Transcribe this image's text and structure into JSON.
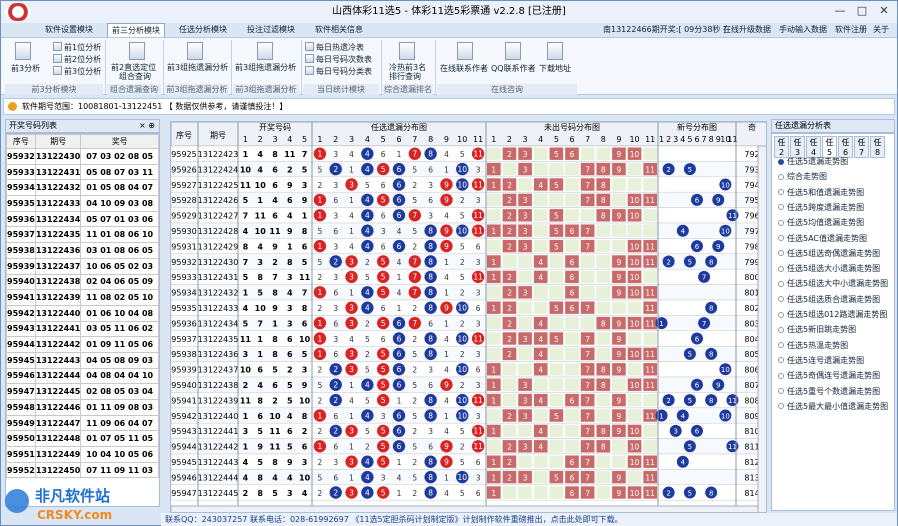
{
  "window": {
    "title": "山西体彩11选5 - 体彩11选5彩票通 v2.2.8 [已注册]"
  },
  "menu": {
    "tabs": [
      "软件设置模块",
      "前三分析模块",
      "任选分析模块",
      "投注过滤模块",
      "软件相关信息"
    ],
    "right": [
      "南13122466期开奖:[ 09分38秒 ]",
      "在线升级数据",
      "手动输入数据",
      "软件注册",
      "关于"
    ]
  },
  "ribbon": {
    "items": [
      {
        "label": "前3分析",
        "icon": "chart-doc-icon"
      },
      {
        "label": "前1位分析",
        "icon": "doc-icon"
      },
      {
        "label": "前2位分析",
        "icon": "doc-icon"
      },
      {
        "label": "前3位分析",
        "icon": "doc-icon"
      },
      {
        "label": "前2直选定位",
        "icon": "doc-icon"
      },
      {
        "label": "组合查询",
        "icon": ""
      },
      {
        "label": "前3组拖遗漏分析",
        "icon": "doc-icon"
      },
      {
        "label": "前3组拖遗漏分析",
        "icon": "doc-icon"
      },
      {
        "label": "每日热遗冷表",
        "icon": "table-icon"
      },
      {
        "label": "每日号码次数表",
        "icon": "table-icon"
      },
      {
        "label": "每日号码分类表",
        "icon": "table-icon"
      },
      {
        "label": "冷热前3名",
        "icon": "search-doc-icon"
      },
      {
        "label": "排行查询",
        "icon": ""
      },
      {
        "label": "在线联系作者",
        "icon": "people-icon"
      },
      {
        "label": "QQ联系作者",
        "icon": "qq-icon"
      },
      {
        "label": "下载地址",
        "icon": "qr-icon"
      }
    ],
    "groups": [
      "前3分析模块",
      "组合遗漏查询",
      "前3组拖遗漏分析",
      "前3组拖遗漏分析",
      "当日统计模块",
      "综合遗漏排名",
      "在线咨询"
    ]
  },
  "infobar": "软件期号范围：10081801-13122451  【 数据仅供参考，请谨慎投注！】",
  "left": {
    "title": "开奖号码列表",
    "cols": [
      "序号",
      "期号",
      "奖号"
    ],
    "rows": [
      [
        "95932",
        "13122430",
        "07 03 02 08 05"
      ],
      [
        "95933",
        "13122431",
        "05 08 07 03 11"
      ],
      [
        "95934",
        "13122432",
        "01 05 08 04 07"
      ],
      [
        "95935",
        "13122433",
        "04 10 09 03 08"
      ],
      [
        "95936",
        "13122434",
        "05 07 01 03 06"
      ],
      [
        "95937",
        "13122435",
        "11 01 08 06 10"
      ],
      [
        "95938",
        "13122436",
        "03 01 08 06 05"
      ],
      [
        "95939",
        "13122437",
        "10 06 05 02 03"
      ],
      [
        "95940",
        "13122438",
        "02 04 06 05 09"
      ],
      [
        "95941",
        "13122439",
        "11 08 02 05 10"
      ],
      [
        "95942",
        "13122440",
        "01 06 10 04 08"
      ],
      [
        "95943",
        "13122441",
        "03 05 11 06 02"
      ],
      [
        "95944",
        "13122442",
        "01 09 11 05 06"
      ],
      [
        "95945",
        "13122443",
        "04 05 08 09 03"
      ],
      [
        "95946",
        "13122444",
        "04 08 04 04 10"
      ],
      [
        "95947",
        "13122445",
        "02 08 05 03 04"
      ],
      [
        "95948",
        "13122446",
        "01 11 09 08 03"
      ],
      [
        "95949",
        "13122447",
        "11 09 06 04 07"
      ],
      [
        "95950",
        "13122448",
        "01 07 05 11 05"
      ],
      [
        "95951",
        "13122449",
        "10 04 10 05 06"
      ],
      [
        "95952",
        "13122450",
        "07 11 09 11 03"
      ]
    ]
  },
  "center": {
    "headers": [
      "序号",
      "期号",
      "开奖号码",
      "任选遗漏分布图",
      "未出号码分布图",
      "新号分布图",
      "奇"
    ],
    "nums": [
      "1",
      "2",
      "3",
      "4",
      "5",
      "6",
      "7",
      "8",
      "9",
      "10",
      "11"
    ],
    "rows": [
      [
        "95925",
        "13122423",
        "1 4 8 11 7",
        "792"
      ],
      [
        "95926",
        "13122424",
        "10 4 6 2 5",
        "793"
      ],
      [
        "95927",
        "13122425",
        "11 10 6 9 3",
        "794"
      ],
      [
        "95928",
        "13122426",
        "5 1 4 6 9",
        "795"
      ],
      [
        "95929",
        "13122427",
        "7 11 6 4 1",
        "796"
      ],
      [
        "95930",
        "13122428",
        "4 10 11 9 8",
        "797"
      ],
      [
        "95931",
        "13122429",
        "8 4 9 1 6",
        "798"
      ],
      [
        "95932",
        "13122430",
        "7 3 2 8 5",
        "799"
      ],
      [
        "95933",
        "13122431",
        "5 8 7 3 11",
        "800"
      ],
      [
        "95934",
        "13122432",
        "1 5 8 4 7",
        "801"
      ],
      [
        "95935",
        "13122433",
        "4 10 9 3 8",
        "802"
      ],
      [
        "95936",
        "13122434",
        "5 7 1 3 6",
        "803"
      ],
      [
        "95937",
        "13122435",
        "11 1 8 6 10",
        "804"
      ],
      [
        "95938",
        "13122436",
        "3 1 8 6 5",
        "805"
      ],
      [
        "95939",
        "13122437",
        "10 6 5 2 3",
        "806"
      ],
      [
        "95940",
        "13122438",
        "2 4 6 5 9",
        "807"
      ],
      [
        "95941",
        "13122439",
        "11 8 2 5 10",
        "808"
      ],
      [
        "95942",
        "13122440",
        "1 6 10 4 8",
        "809"
      ],
      [
        "95943",
        "13122441",
        "3 5 11 6 2",
        "810"
      ],
      [
        "95944",
        "13122442",
        "1 9 11 5 6",
        "811"
      ],
      [
        "95945",
        "13122443",
        "4 5 8 9 3",
        "812"
      ],
      [
        "95946",
        "13122444",
        "4 8 4 4 10",
        "813"
      ],
      [
        "95947",
        "13122445",
        "2 8 5 3 4",
        "814"
      ]
    ]
  },
  "right": {
    "title": "任选遗漏分析表",
    "tabs": [
      "任2",
      "任3",
      "任4",
      "任5",
      "任6",
      "任7",
      "任8"
    ],
    "items": [
      "任选5遗漏走势图",
      "综合走势图",
      "任选5和值遗漏走势图",
      "任选5跨度遗漏走势图",
      "任选5均值遗漏走势图",
      "任选5AC值遗漏走势图",
      "任选5组选奇偶遗漏走势图",
      "任选5组选大小遗漏走势图",
      "任选5组选大中小遗漏走势图",
      "任选5组选质合遗漏走势图",
      "任选5组选012路遗漏走势图",
      "任选5新旧跳走势图",
      "任选5热温走势图",
      "任选5连号遗漏走势图",
      "任选5奇偶连号遗漏走势图",
      "任选5重号个数遗漏走势图",
      "任选5最大最小值遗漏走势图"
    ]
  },
  "status": {
    "text": "联系QQ：243037257  联系电话：028-61992697  《11选5定胆杀码计划制定版》计划制作软件重磅推出，点击此处即可下载。"
  },
  "colors": {
    "ball_red": "#d82424",
    "ball_blue": "#1e3a9e",
    "miss_bg": "#c86a6a",
    "accent": "#2a4a9a"
  },
  "watermark": {
    "text": "非凡软件站",
    "sub": "CRSKY.com"
  }
}
